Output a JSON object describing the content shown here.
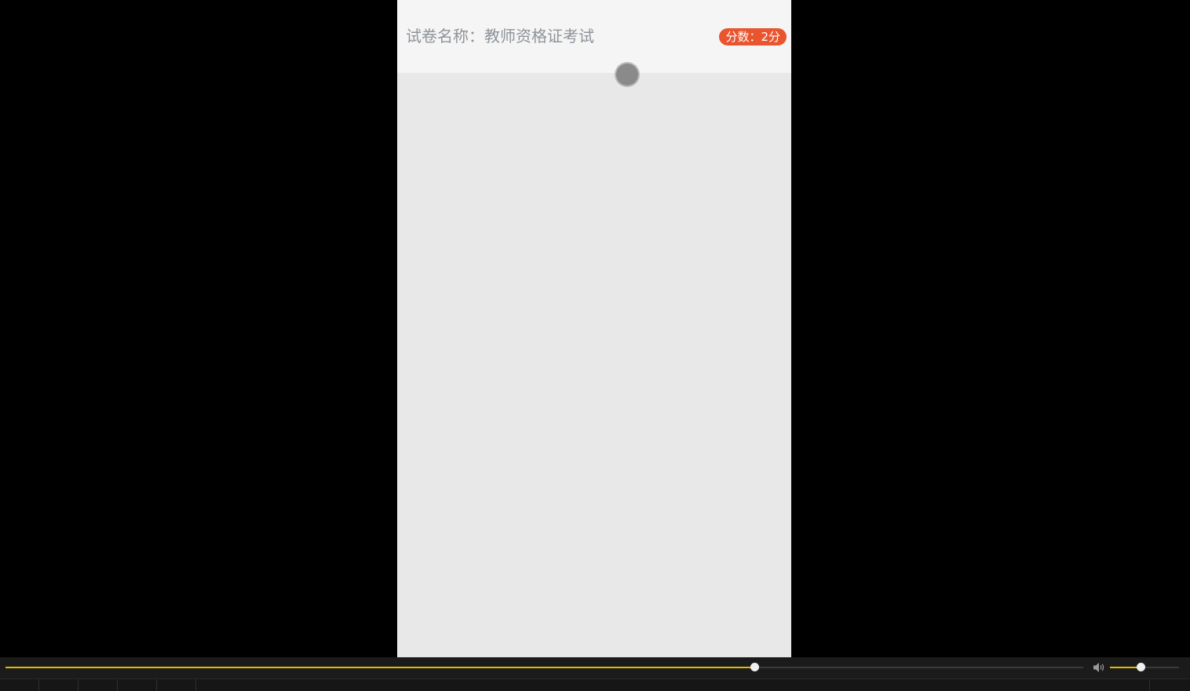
{
  "exam": {
    "title": "试卷名称：教师资格证考试",
    "score_label": "分数：2分"
  },
  "player": {
    "seek_progress": 0.695,
    "volume_level": 0.44
  },
  "colors": {
    "accent": "#e6b800",
    "badge": "#e8552f",
    "title_text": "#8e9399"
  },
  "icons": {
    "volume": "speaker-icon"
  }
}
